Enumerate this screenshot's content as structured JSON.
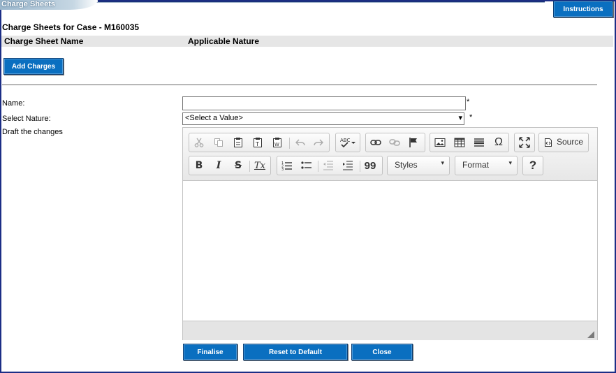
{
  "window": {
    "tab_title": "Charge Sheets"
  },
  "header": {
    "instructions_label": "Instructions",
    "case_title": "Charge Sheets for Case - M160035"
  },
  "grid": {
    "columns": [
      "Charge Sheet Name",
      "Applicable Nature"
    ]
  },
  "actions": {
    "add_charges_label": "Add Charges"
  },
  "form": {
    "name_label": "Name:",
    "name_value": "",
    "required_mark": "*",
    "nature_label": "Select Nature:",
    "nature_selected": "<Select a Value>",
    "nature_caret": "▾",
    "draft_label": "Draft the changes"
  },
  "editor": {
    "source_label": "Source",
    "styles_label": "Styles",
    "format_label": "Format",
    "help_label": "?",
    "combo_caret": "▾",
    "bold_label": "B",
    "italic_label": "I",
    "strike_label": "S",
    "remove_format_label": "Tx",
    "blockquote_label": "99",
    "special_char_label": "Ω"
  },
  "footer": {
    "finalise_label": "Finalise",
    "reset_label": "Reset to Default",
    "close_label": "Close"
  },
  "colors": {
    "button_blue": "#0a6fc0",
    "border_navy": "#1c2e86"
  },
  "icons": {
    "row1": [
      "cut-icon",
      "copy-icon",
      "paste-icon",
      "paste-text-icon",
      "paste-word-icon",
      "undo-icon",
      "redo-icon",
      "spellcheck-icon",
      "link-icon",
      "unlink-icon",
      "anchor-icon",
      "image-icon",
      "table-icon",
      "horizontal-rule-icon",
      "special-char-icon",
      "maximize-icon",
      "source-icon"
    ],
    "row2": [
      "bold-icon",
      "italic-icon",
      "strike-icon",
      "remove-format-icon",
      "numbered-list-icon",
      "bulleted-list-icon",
      "outdent-icon",
      "indent-icon",
      "blockquote-icon",
      "help-icon"
    ]
  }
}
